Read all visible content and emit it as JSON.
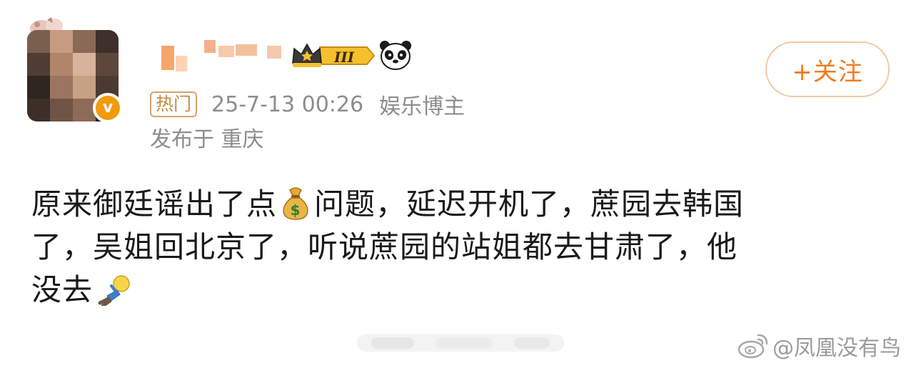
{
  "header": {
    "level_badge": "III",
    "follow_button_label": "+关注"
  },
  "meta": {
    "hot_tag": "热门",
    "timestamp": "25-7-13 00:26",
    "role": "娱乐博主",
    "location": "发布于 重庆"
  },
  "post": {
    "line1_part1": "原来御廷谣出了点",
    "line1_part2": "问题，延迟开机了，蔗园去韩国",
    "line2": "了，吴姐回北京了，听说蔗园的站姐都去甘肃了，他",
    "line3": "没去",
    "emojis": [
      "money-bag-emoji",
      "lying-down-emoji"
    ]
  },
  "watermark": {
    "text": "@凤凰没有鸟"
  },
  "colors": {
    "accent_orange": "#f27c1d",
    "follow_border": "#f0c9a6",
    "hot_tag": "#c58846",
    "meta_gray": "#8d8d8d",
    "verified_badge": "#f29a0d"
  }
}
